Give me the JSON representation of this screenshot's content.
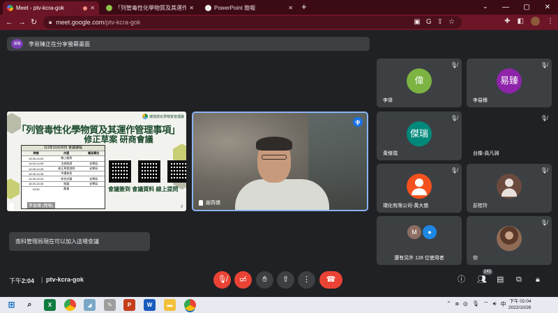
{
  "browser": {
    "tabs": [
      {
        "label": "Meet - ptv-kcra-gok",
        "active": true
      },
      {
        "label": "「列管毒性化學物質及其運作管理」",
        "active": false
      },
      {
        "label": "PowerPoint 簡報",
        "active": false
      }
    ],
    "new_tab": "+",
    "url_host": "meet.google.com",
    "url_path": "/ptv-kcra-gok",
    "window": {
      "minimize": "—",
      "maximize": "▢",
      "close": "✕"
    }
  },
  "presenting": {
    "chip": "易臻",
    "text": "李易臻正在分享螢幕畫面"
  },
  "slide": {
    "org": "環境部化學物質管理署",
    "title": "「列管毒性化學物質及其運作管理事項」",
    "subtitle": "修正草案 研商會議",
    "agenda_title": "111年10月26日 會議議程",
    "agenda_headers": [
      "時間",
      "內容",
      "報告單位"
    ],
    "agenda_rows": [
      [
        "13:30-14:00",
        "線上報到",
        "-"
      ],
      [
        "14:00-14:05",
        "主席致詞",
        "化學局"
      ],
      [
        "14:05-14:25",
        "修正草案說明",
        "化學局"
      ],
      [
        "14:25-14:35",
        "中場休息",
        "-"
      ],
      [
        "14:35-15:20",
        "綜合討論",
        "化學局"
      ],
      [
        "15:20-15:30",
        "結論",
        "化學局"
      ],
      [
        "15:30",
        "散會",
        ""
      ]
    ],
    "qr_labels": "會議簽到 會議資料 線上提問",
    "page": "2",
    "speaker": "李易臻 (簡報)"
  },
  "camera": {
    "name": "謝燕儒"
  },
  "participants": [
    {
      "name": "李偉",
      "initials": "偉",
      "color": "#7cb342"
    },
    {
      "name": "李易臻",
      "initials": "易臻",
      "color": "#8e24aa"
    },
    {
      "name": "黃傑瑞",
      "initials": "傑瑞",
      "color": "#00897b"
    },
    {
      "name": "台橡-員凡淵",
      "initials": "",
      "color": ""
    },
    {
      "name": "環化有限公司-黃大慈",
      "initials": "",
      "color": "#f4511e"
    },
    {
      "name": "彭桂玲",
      "initials": "",
      "color": "#6b4a3e"
    },
    {
      "name": "還有另外 128 位使用者",
      "initials": "M",
      "color": "#8d6e63"
    },
    {
      "name": "你",
      "initials": "",
      "color": ""
    }
  ],
  "toast": "南科管理局現在可以加入這場會議",
  "bottom": {
    "time_prefix": "下午",
    "time": "2:04",
    "separator": "|",
    "meeting_code": "ptv-kcra-gok",
    "people_count": "142"
  },
  "taskbar": {
    "clock_time": "下午 02:04",
    "clock_date": "2022/10/26",
    "ime": "中"
  },
  "colors": {
    "accent_red": "#ea4335",
    "browser_frame": "#6b1526",
    "speaking_blue": "#1a73e8"
  }
}
